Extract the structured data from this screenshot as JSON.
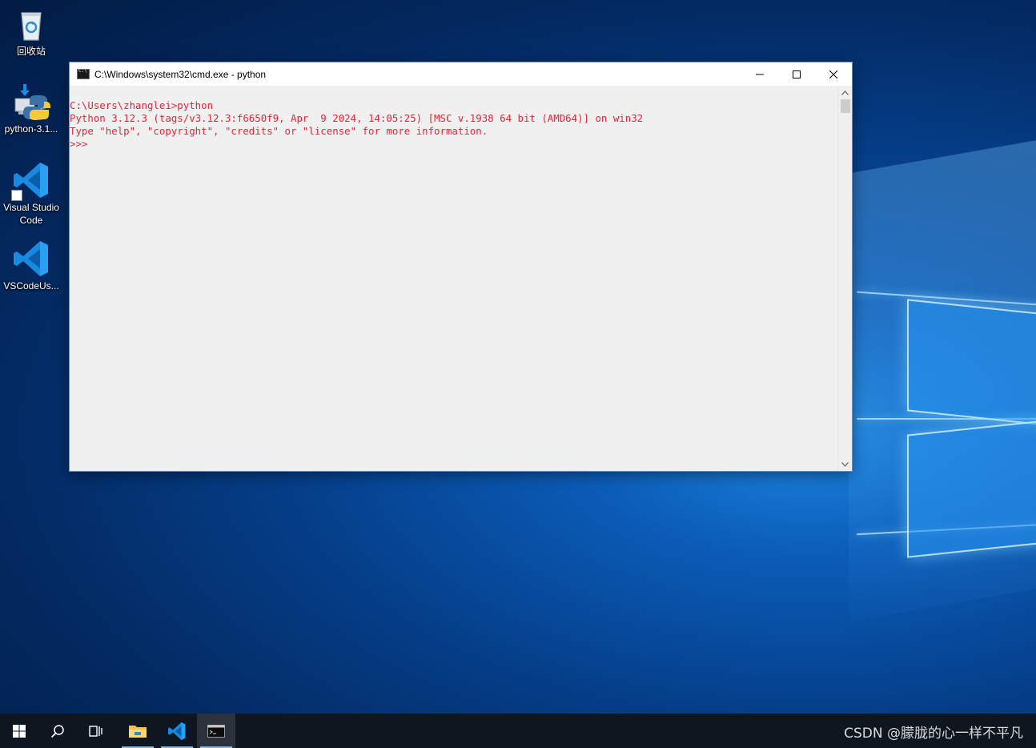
{
  "desktop": {
    "icons": [
      {
        "label": "回收站",
        "icon": "recycle-bin-icon"
      },
      {
        "label": "python-3.1...",
        "icon": "python-installer-icon"
      },
      {
        "label": "Visual Studio Code",
        "icon": "vscode-icon"
      },
      {
        "label": "VSCodeUs...",
        "icon": "vscode-icon"
      }
    ]
  },
  "window": {
    "title": "C:\\Windows\\system32\\cmd.exe - python",
    "console_lines": [
      "C:\\Users\\zhanglei>python",
      "Python 3.12.3 (tags/v3.12.3:f6650f9, Apr  9 2024, 14:05:25) [MSC v.1938 64 bit (AMD64)] on win32",
      "Type \"help\", \"copyright\", \"credits\" or \"license\" for more information.",
      ">>>"
    ],
    "text_color": "#e8253b",
    "background_color": "#f0f0f0"
  },
  "taskbar": {
    "items": [
      "start-icon",
      "search-icon",
      "task-view-icon",
      "file-explorer-icon",
      "vscode-icon",
      "cmd-icon"
    ],
    "watermark": "CSDN @朦胧的心一样不平凡"
  }
}
